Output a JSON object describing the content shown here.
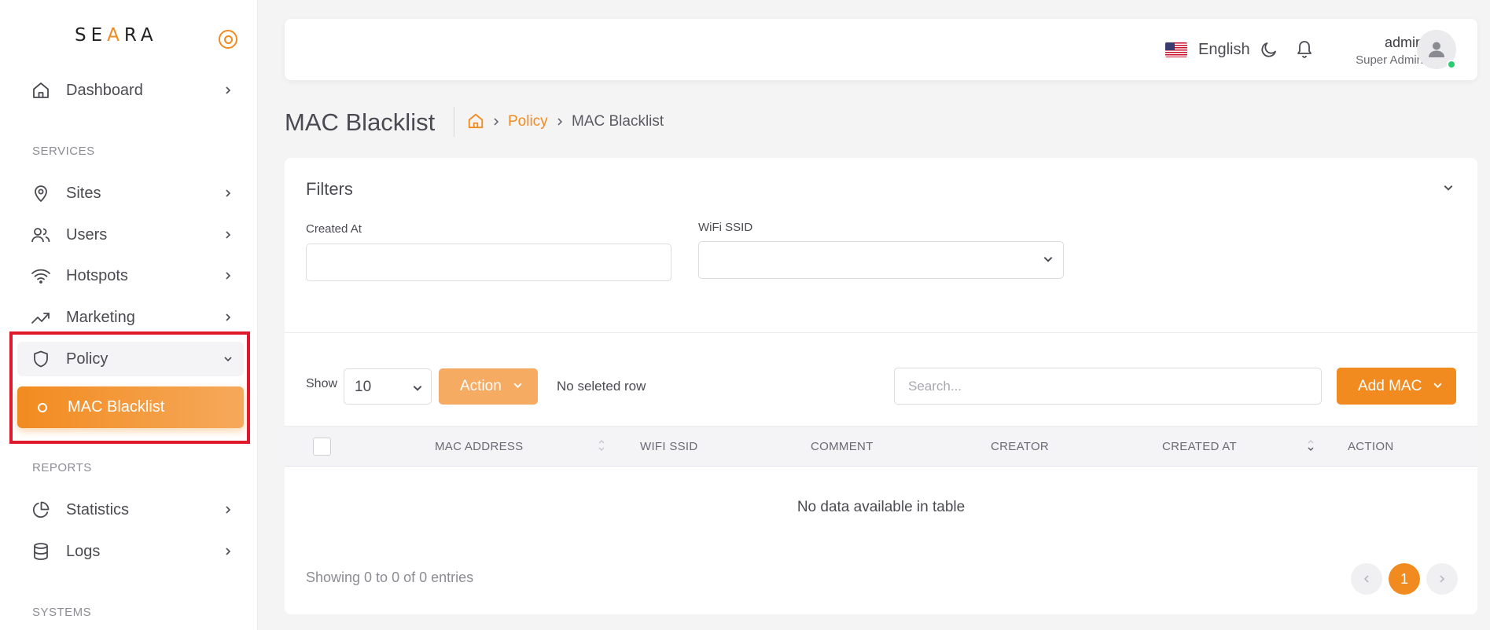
{
  "brand": {
    "logo_pre": "SE",
    "logo_accent": "A",
    "logo_post": "RA",
    "accent": "#f28b1f"
  },
  "sidebar": {
    "dashboard": "Dashboard",
    "section_services": "SERVICES",
    "sites": "Sites",
    "users": "Users",
    "hotspots": "Hotspots",
    "marketing": "Marketing",
    "policy": "Policy",
    "mac_blacklist": "MAC Blacklist",
    "section_reports": "REPORTS",
    "statistics": "Statistics",
    "logs": "Logs",
    "section_systems": "SYSTEMS"
  },
  "header": {
    "language": "English",
    "user_name": "admin",
    "user_role": "Super Admin"
  },
  "page": {
    "title": "MAC Blacklist",
    "breadcrumb_policy": "Policy",
    "breadcrumb_current": "MAC Blacklist"
  },
  "filters": {
    "title": "Filters",
    "created_at_label": "Created At",
    "wifi_ssid_label": "WiFi SSID"
  },
  "toolbar": {
    "show_label": "Show",
    "page_size": "10",
    "action_label": "Action",
    "selection_status": "No seleted row",
    "search_placeholder": "Search...",
    "add_label": "Add MAC"
  },
  "table": {
    "columns": [
      "MAC ADDRESS",
      "WIFI SSID",
      "COMMENT",
      "CREATOR",
      "CREATED AT",
      "ACTION"
    ],
    "empty_message": "No data available in table",
    "showing": "Showing 0 to 0 of 0 entries",
    "current_page": "1"
  }
}
